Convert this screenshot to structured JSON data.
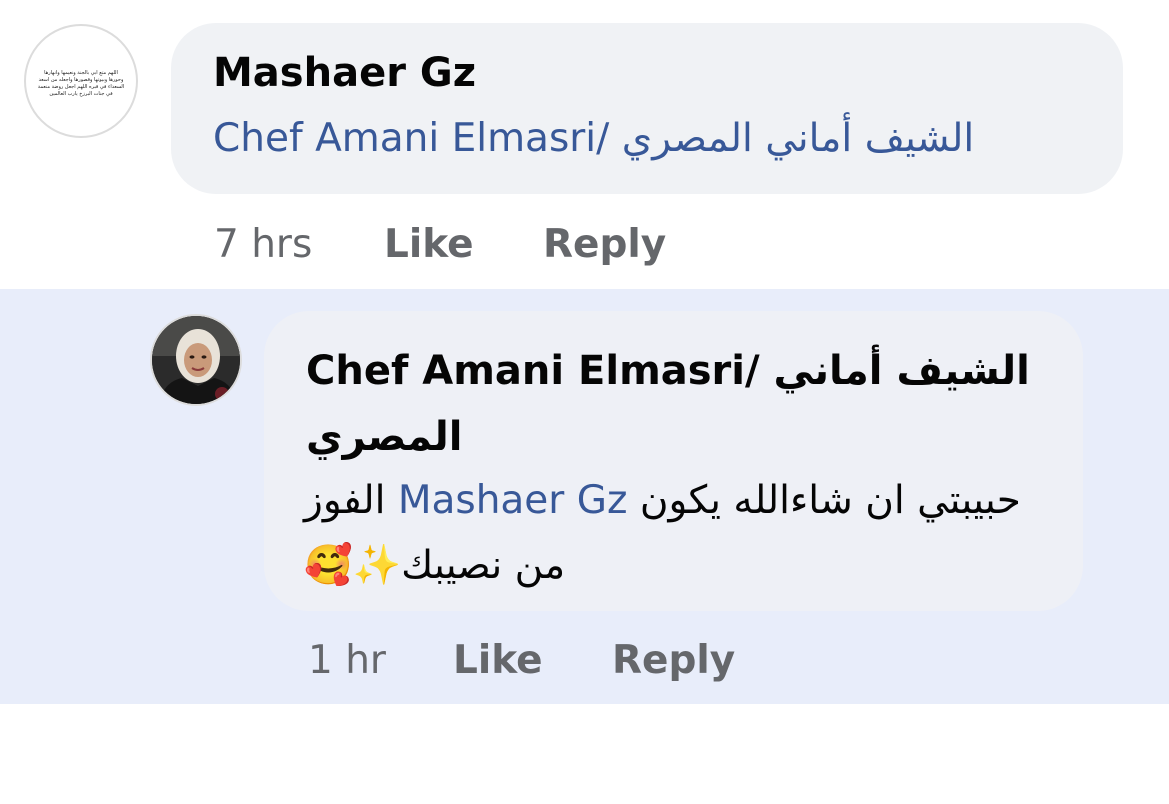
{
  "comment": {
    "author": "Mashaer Gz",
    "avatar_caption": "اللهم متع ابي بالجنة ونعيمها وانهارها وحورها وبيوتها وقصورها واجعله من اسعد السعداء في قبره اللهم اجعل روضة منعمة في جنات البرزخ يارب العالمين",
    "mention": "Chef Amani Elmasri/ الشيف أماني المصري",
    "time": "7 hrs",
    "like_label": "Like",
    "reply_label": "Reply"
  },
  "reply": {
    "author": "Chef Amani Elmasri/ الشيف أماني المصري",
    "mention": "Mashaer Gz",
    "text_before": "حبيبتي ان شاءالله يكون ",
    "text_after": " الفوز من نصيبك✨🥰",
    "time": "1 hr",
    "like_label": "Like",
    "reply_label": "Reply"
  },
  "colors": {
    "link": "#385898",
    "meta": "#65676b",
    "bubble": "#f0f2f5",
    "highlight": "#e8edfa"
  }
}
